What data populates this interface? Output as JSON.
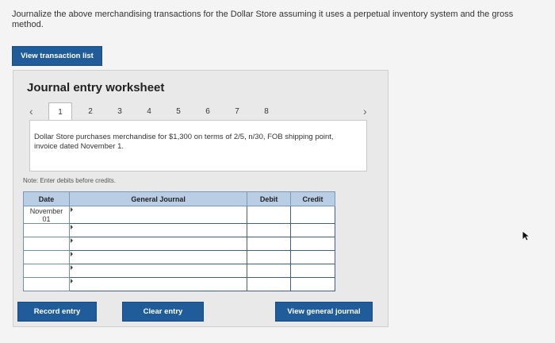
{
  "instructions": "Journalize the above merchandising transactions for the Dollar Store assuming it uses a perpetual inventory system and the gross method.",
  "buttons": {
    "view_transaction_list": "View transaction list",
    "record_entry": "Record entry",
    "clear_entry": "Clear entry",
    "view_general_journal": "View general journal"
  },
  "worksheet": {
    "title": "Journal entry worksheet",
    "tabs": [
      "1",
      "2",
      "3",
      "4",
      "5",
      "6",
      "7",
      "8"
    ],
    "prev_icon": "chevron-left-icon",
    "next_icon": "chevron-right-icon",
    "description": "Dollar Store purchases merchandise for $1,300 on terms of 2/5, n/30, FOB shipping point, invoice dated November 1.",
    "note": "Note: Enter debits before credits."
  },
  "journal": {
    "headers": [
      "Date",
      "General Journal",
      "Debit",
      "Credit"
    ],
    "rows": [
      {
        "date": "November\n01"
      },
      {
        "date": ""
      },
      {
        "date": ""
      },
      {
        "date": ""
      },
      {
        "date": ""
      },
      {
        "date": ""
      }
    ]
  },
  "colors": {
    "button": "#1f5c99",
    "header": "#b9cde5"
  }
}
